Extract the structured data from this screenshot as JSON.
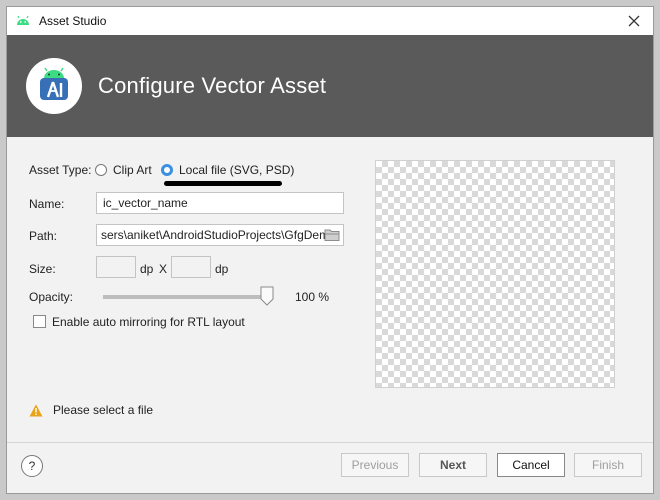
{
  "window": {
    "title": "Asset Studio"
  },
  "banner": {
    "heading": "Configure Vector Asset"
  },
  "form": {
    "asset_type_label": "Asset Type:",
    "asset_type_options": [
      "Clip Art",
      "Local file (SVG, PSD)"
    ],
    "asset_type_selected": "Local file (SVG, PSD)",
    "name_label": "Name:",
    "name_value": "ic_vector_name",
    "path_label": "Path:",
    "path_value": "sers\\aniket\\AndroidStudioProjects\\GfgDemo",
    "size_label": "Size:",
    "size_unit": "dp",
    "size_separator": "X",
    "size_unit2": "dp",
    "opacity_label": "Opacity:",
    "opacity_value_text": "100 %",
    "opacity_value": 1.0,
    "auto_mirror_label": "Enable auto mirroring for RTL layout",
    "auto_mirror_checked": false
  },
  "status": {
    "warning_text": "Please select a file"
  },
  "footer": {
    "help_label": "?",
    "previous_label": "Previous",
    "next_label": "Next",
    "cancel_label": "Cancel",
    "finish_label": "Finish"
  },
  "colors": {
    "banner": "#5a5a5a",
    "accent": "#3d8fe0",
    "warning": "#e8a317",
    "android_green": "#3ddc84"
  },
  "icons": [
    "android-icon",
    "close-icon",
    "android-studio-logo",
    "folder-icon",
    "warning-icon",
    "help-icon"
  ]
}
